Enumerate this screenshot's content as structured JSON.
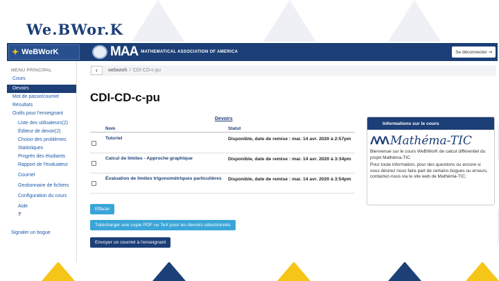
{
  "slide": {
    "title": "We.BWor.K"
  },
  "topbar": {
    "logo": "WeBWorK",
    "maa_big": "MAA",
    "maa_small": "MATHEMATICAL ASSOCIATION OF AMERICA",
    "logout": "Se déconnecter"
  },
  "sidebar": {
    "heading": "MENU PRINCIPAL",
    "items": [
      "Cours",
      "Devoirs",
      "Mot de passe/courriel",
      "Résultats",
      "Outils pour l'enseignant",
      "Liste des utilisateurs(2)",
      "Éditeur de devoir(2)",
      "Choisir des problèmes",
      "Statistiques",
      "Progrès des étudiants",
      "Rapport de l'évaluateur",
      "Courriel",
      "Gestionnaire de fichiers",
      "Configuration du cours",
      "Aide",
      "Signaler un bogue"
    ]
  },
  "breadcrumb": {
    "back": "‹",
    "root": "webwork",
    "sep": "/",
    "current": "CDI-CD-c-pu"
  },
  "page": {
    "title": "CDI-CD-c-pu"
  },
  "table": {
    "caption": "Devoirs",
    "col_name": "Nom",
    "col_status": "Statut",
    "rows": [
      {
        "name": "Tutoriel",
        "status": "Disponible, date de remise : mar. 14 avr. 2020 à 2:57pm"
      },
      {
        "name": "Calcul de limites - Approche graphique",
        "status": "Disponible, date de remise : mar. 14 avr. 2020 à 3:34pm"
      },
      {
        "name": "Évaluation de limites trigonométriques particulières",
        "status": "Disponible, date de remise : mar. 14 avr. 2020 à 3:54pm"
      }
    ]
  },
  "buttons": {
    "delete": "Effacer",
    "download": "Télécharger une copie PDF ou TeX pour les devoirs sélectionnés",
    "email": "Envoyer un courriel à l'enseignant"
  },
  "info": {
    "heading": "Informations sur le cours",
    "logo_text": "Mathéma-TIC",
    "p1": "Bienvenue sur le cours WeBWorK de calcul différentiel du projet Mathéma-TIC.",
    "p2": "Pour toute information, pour des questions ou encore si vous désirez nous faire part de certains bogues ou erreurs, contactez-nous via le site web de Mathéma-TIC."
  },
  "colors": {
    "navy": "#1c3f77",
    "accent": "#3aa5d8",
    "yellow": "#f5c518"
  }
}
